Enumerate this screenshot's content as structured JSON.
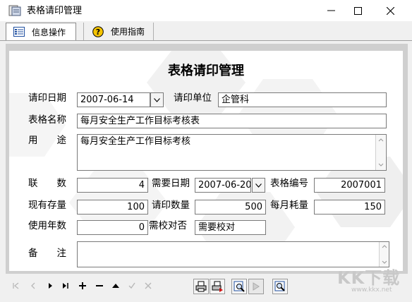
{
  "window": {
    "title": "表格请印管理"
  },
  "tabs": [
    {
      "label": "信息操作"
    },
    {
      "label": "使用指南"
    }
  ],
  "form": {
    "heading": "表格请印管理",
    "request_date_label": "请印日期",
    "request_date_value": "2007-06-14",
    "request_unit_label": "请印单位",
    "request_unit_value": "企管科",
    "form_name_label": "表格名称",
    "form_name_value": "每月安全生产工作目标考核表",
    "purpose_label": "用　　途",
    "purpose_value": "每月安全生产工作目标考核",
    "copies_label": "联　　数",
    "copies_value": "4",
    "need_date_label": "需要日期",
    "need_date_value": "2007-06-20",
    "form_no_label": "表格编号",
    "form_no_value": "2007001",
    "stock_label": "现有存量",
    "stock_value": "100",
    "print_qty_label": "请印数量",
    "print_qty_value": "500",
    "monthly_use_label": "每月耗量",
    "monthly_use_value": "150",
    "years_label": "使用年数",
    "years_value": "0",
    "proofread_label": "需校对否",
    "proofread_value": "需要校对",
    "remarks_label": "备　　注",
    "remarks_value": ""
  },
  "watermark": {
    "text": "KK下载",
    "url": "www.kkx.net"
  },
  "colors": {
    "accent_blue": "#1f4fa0",
    "arrow_red": "#d01010"
  }
}
